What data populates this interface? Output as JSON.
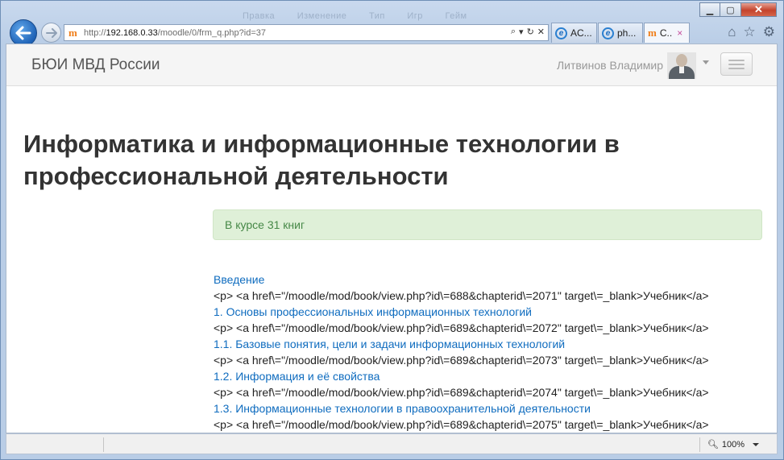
{
  "browser": {
    "url_prefix": "http://",
    "url_host": "192.168.0.33",
    "url_path": "/moodle/0/frm_q.php?id=37",
    "tabs": [
      {
        "label": "AC...",
        "icon": "ie-icon"
      },
      {
        "label": "ph...",
        "icon": "ie-icon"
      },
      {
        "label": "C..",
        "icon": "moodle-icon"
      }
    ],
    "close_tab_glyph": "×",
    "zoom_label": "100%",
    "ghost_menu": [
      "Правка",
      "Изменение",
      "Тип",
      "Игр",
      "Гейм"
    ]
  },
  "navbar": {
    "brand": "БЮИ МВД России",
    "user_name": "Литвинов Владимир"
  },
  "page": {
    "title": "Информатика и информационные технологии в профессиональной деятельности",
    "alert_text": "В курсе 31 книг"
  },
  "books": [
    {
      "type": "link",
      "text": "Введение"
    },
    {
      "type": "code",
      "text": "<p> <a href\\=\"/moodle/mod/book/view.php?id\\=688&chapterid\\=2071\" target\\=_blank>Учебник</a>"
    },
    {
      "type": "link",
      "text": "1. Основы профессиональных информационных технологий"
    },
    {
      "type": "code",
      "text": "<p> <a href\\=\"/moodle/mod/book/view.php?id\\=689&chapterid\\=2072\" target\\=_blank>Учебник</a>"
    },
    {
      "type": "link",
      "text": "1.1.  Базовые понятия, цели и задачи информационных технологий"
    },
    {
      "type": "code",
      "text": "<p> <a href\\=\"/moodle/mod/book/view.php?id\\=689&chapterid\\=2073\" target\\=_blank>Учебник</a>"
    },
    {
      "type": "link",
      "text": "1.2. Информация и её свойства"
    },
    {
      "type": "code",
      "text": "<p> <a href\\=\"/moodle/mod/book/view.php?id\\=689&chapterid\\=2074\" target\\=_blank>Учебник</a>"
    },
    {
      "type": "link",
      "text": "1.3. Информационные технологии в правоохранительной деятельности"
    },
    {
      "type": "code",
      "text": "<p> <a href\\=\"/moodle/mod/book/view.php?id\\=689&chapterid\\=2075\" target\\=_blank>Учебник</a>"
    }
  ]
}
